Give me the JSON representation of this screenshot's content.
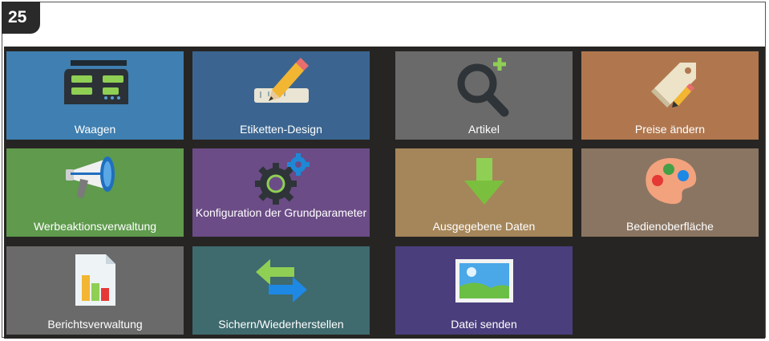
{
  "page": {
    "number": "25"
  },
  "tiles": [
    {
      "label": "Waagen",
      "color": "#3f7fb1",
      "icon": "scale-icon"
    },
    {
      "label": "Etiketten-Design",
      "color": "#3b6590",
      "icon": "label-design-icon"
    },
    {
      "label": "Artikel",
      "color": "#6a6a6a",
      "icon": "search-plus-icon"
    },
    {
      "label": "Preise ändern",
      "color": "#b0774f",
      "icon": "price-tag-icon"
    },
    {
      "label": "Werbeaktionsverwaltung",
      "color": "#5f9a4d",
      "icon": "megaphone-icon"
    },
    {
      "label": "Konfiguration der Grundparameter",
      "color": "#6b4c86",
      "icon": "gears-icon"
    },
    {
      "label": "Ausgegebene Daten",
      "color": "#a5865a",
      "icon": "download-arrow-icon"
    },
    {
      "label": "Bedienoberfläche",
      "color": "#8a7562",
      "icon": "palette-icon"
    },
    {
      "label": "Berichtsverwaltung",
      "color": "#6a6a6a",
      "icon": "report-chart-icon"
    },
    {
      "label": "Sichern/Wiederherstellen",
      "color": "#3f6a6e",
      "icon": "swap-arrows-icon"
    },
    {
      "label": "Datei senden",
      "color": "#4a3f7c",
      "icon": "picture-file-icon"
    }
  ]
}
